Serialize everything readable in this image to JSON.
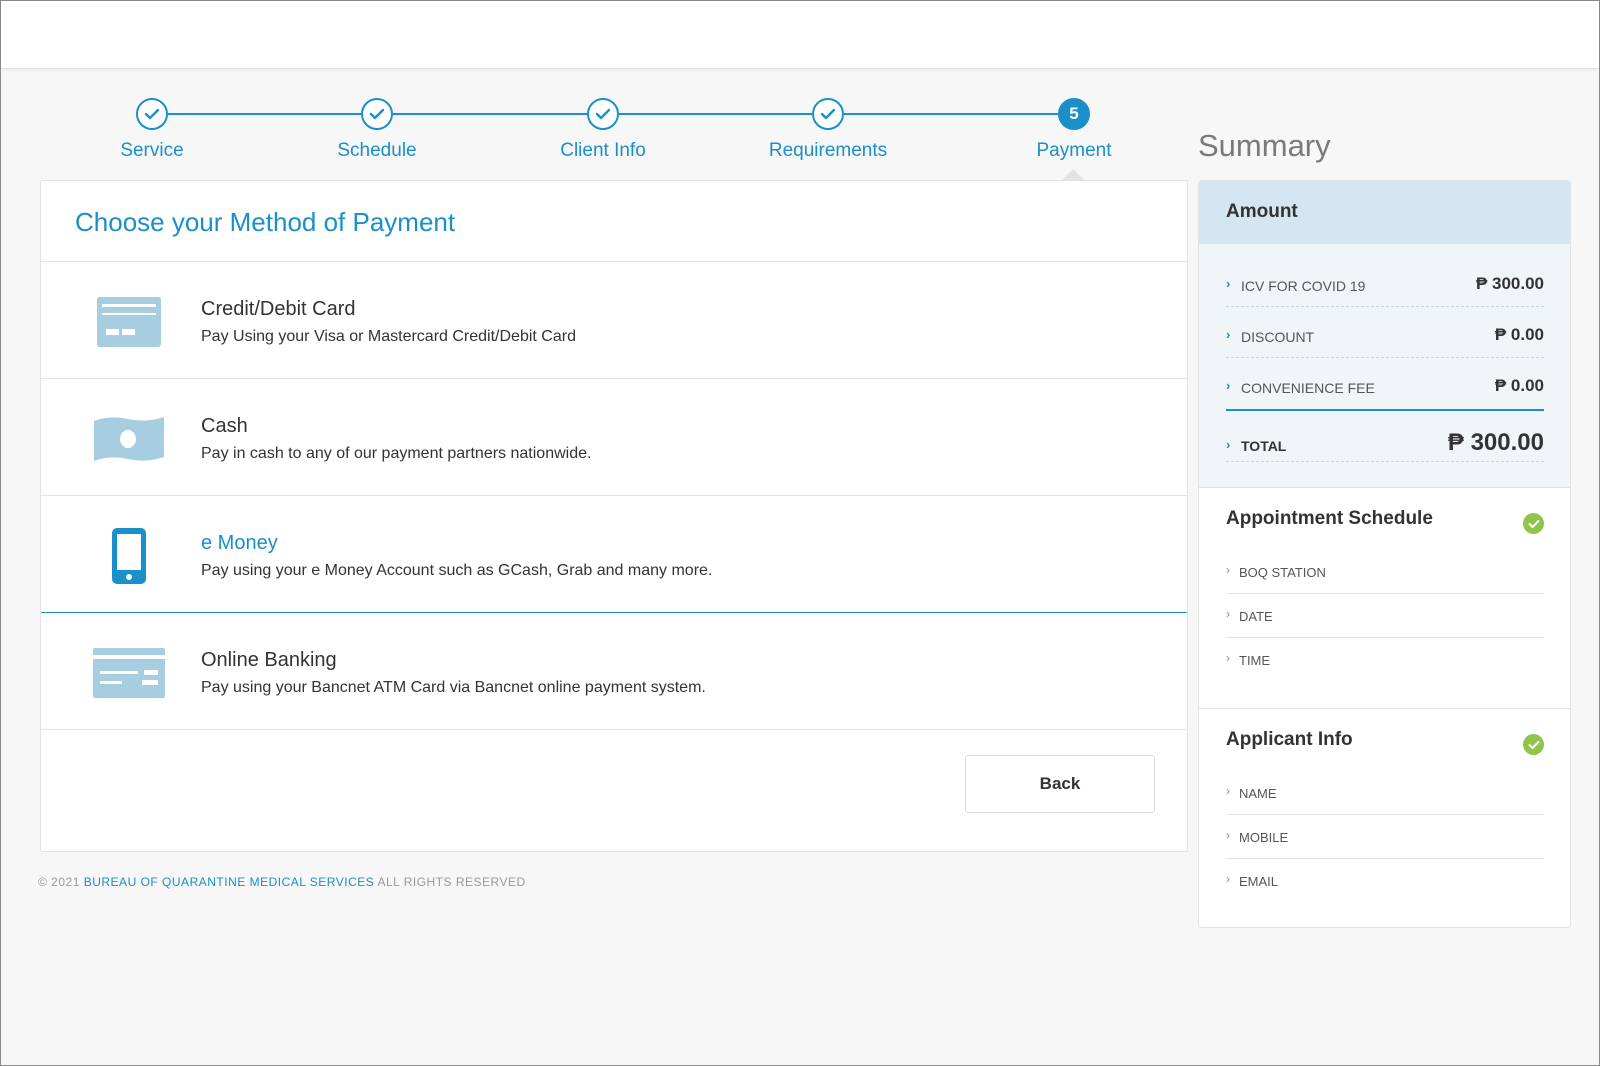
{
  "steps": [
    {
      "label": "Service",
      "status": "done"
    },
    {
      "label": "Schedule",
      "status": "done"
    },
    {
      "label": "Client Info",
      "status": "done"
    },
    {
      "label": "Requirements",
      "status": "done"
    },
    {
      "label": "Payment",
      "status": "active",
      "number": "5"
    }
  ],
  "main": {
    "title": "Choose your Method of Payment",
    "methods": [
      {
        "name": "Credit/Debit Card",
        "desc": "Pay Using your Visa or Mastercard Credit/Debit Card",
        "icon": "credit-card-icon"
      },
      {
        "name": "Cash",
        "desc": "Pay in cash to any of our payment partners nationwide.",
        "icon": "cash-icon"
      },
      {
        "name": "e Money",
        "desc": "Pay using your e Money Account such as GCash, Grab and many more.",
        "icon": "smartphone-icon"
      },
      {
        "name": "Online Banking",
        "desc": "Pay using your Bancnet ATM Card via Bancnet online payment system.",
        "icon": "bank-card-icon"
      }
    ],
    "back_label": "Back"
  },
  "footer": {
    "copyright": "© 2021",
    "org": "BUREAU OF QUARANTINE MEDICAL SERVICES",
    "rights": "ALL RIGHTS RESERVED"
  },
  "summary": {
    "heading": "Summary",
    "amount": {
      "title": "Amount",
      "rows": [
        {
          "label": "ICV FOR COVID 19",
          "value": "₱ 300.00"
        },
        {
          "label": "DISCOUNT",
          "value": "₱ 0.00"
        },
        {
          "label": "CONVENIENCE FEE",
          "value": "₱ 0.00"
        }
      ],
      "total_label": "TOTAL",
      "total_value": "₱ 300.00"
    },
    "schedule": {
      "title": "Appointment Schedule",
      "items": [
        "BOQ STATION",
        "DATE",
        "TIME"
      ]
    },
    "applicant": {
      "title": "Applicant Info",
      "items": [
        "NAME",
        "MOBILE",
        "EMAIL"
      ]
    }
  },
  "colors": {
    "accent": "#1a8fc9",
    "icon_fill": "#a7cde0",
    "selected_icon": "#1a8fc9",
    "check_green": "#8ec54a"
  }
}
